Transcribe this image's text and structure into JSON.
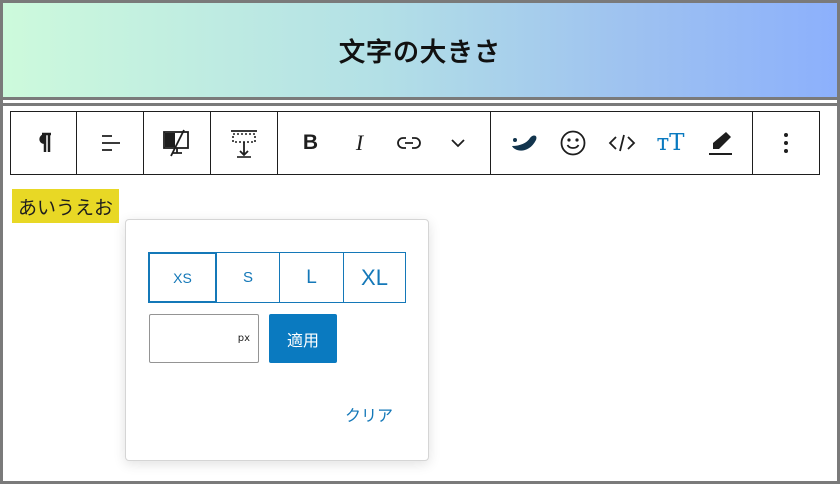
{
  "banner": {
    "title": "文字の大きさ"
  },
  "toolbar": {
    "groups": [
      {
        "name": "paragraph",
        "items": [
          {
            "icon": "pilcrow-icon"
          }
        ]
      },
      {
        "name": "align",
        "items": [
          {
            "icon": "align-right-icon"
          }
        ]
      },
      {
        "name": "responsive",
        "items": [
          {
            "icon": "device-hide-icon"
          }
        ]
      },
      {
        "name": "height",
        "items": [
          {
            "icon": "vertical-spacing-icon"
          }
        ]
      },
      {
        "name": "format",
        "items": [
          {
            "icon": "bold-icon",
            "glyph": "B"
          },
          {
            "icon": "italic-icon",
            "glyph": "I"
          },
          {
            "icon": "link-icon"
          },
          {
            "icon": "chevron-down-icon"
          }
        ]
      },
      {
        "name": "extensions",
        "items": [
          {
            "icon": "brand-blob-icon"
          },
          {
            "icon": "emoji-smile-icon"
          },
          {
            "icon": "code-icon"
          },
          {
            "icon": "font-size-icon",
            "glyph": "тT"
          },
          {
            "icon": "highlighter-icon"
          }
        ]
      },
      {
        "name": "more",
        "items": [
          {
            "icon": "more-vertical-icon"
          }
        ]
      }
    ]
  },
  "editor": {
    "highlighted_text": "あいうえお"
  },
  "font_size_popover": {
    "sizes": [
      "XS",
      "S",
      "L",
      "XL"
    ],
    "selected_size": "XS",
    "custom_value": "",
    "unit": "px",
    "apply_label": "適用",
    "clear_label": "クリア"
  },
  "colors": {
    "accent": "#0a7ac0",
    "highlight": "#e8d825",
    "banner_gradient": [
      "#cdfadc",
      "#8cb0fc"
    ]
  }
}
